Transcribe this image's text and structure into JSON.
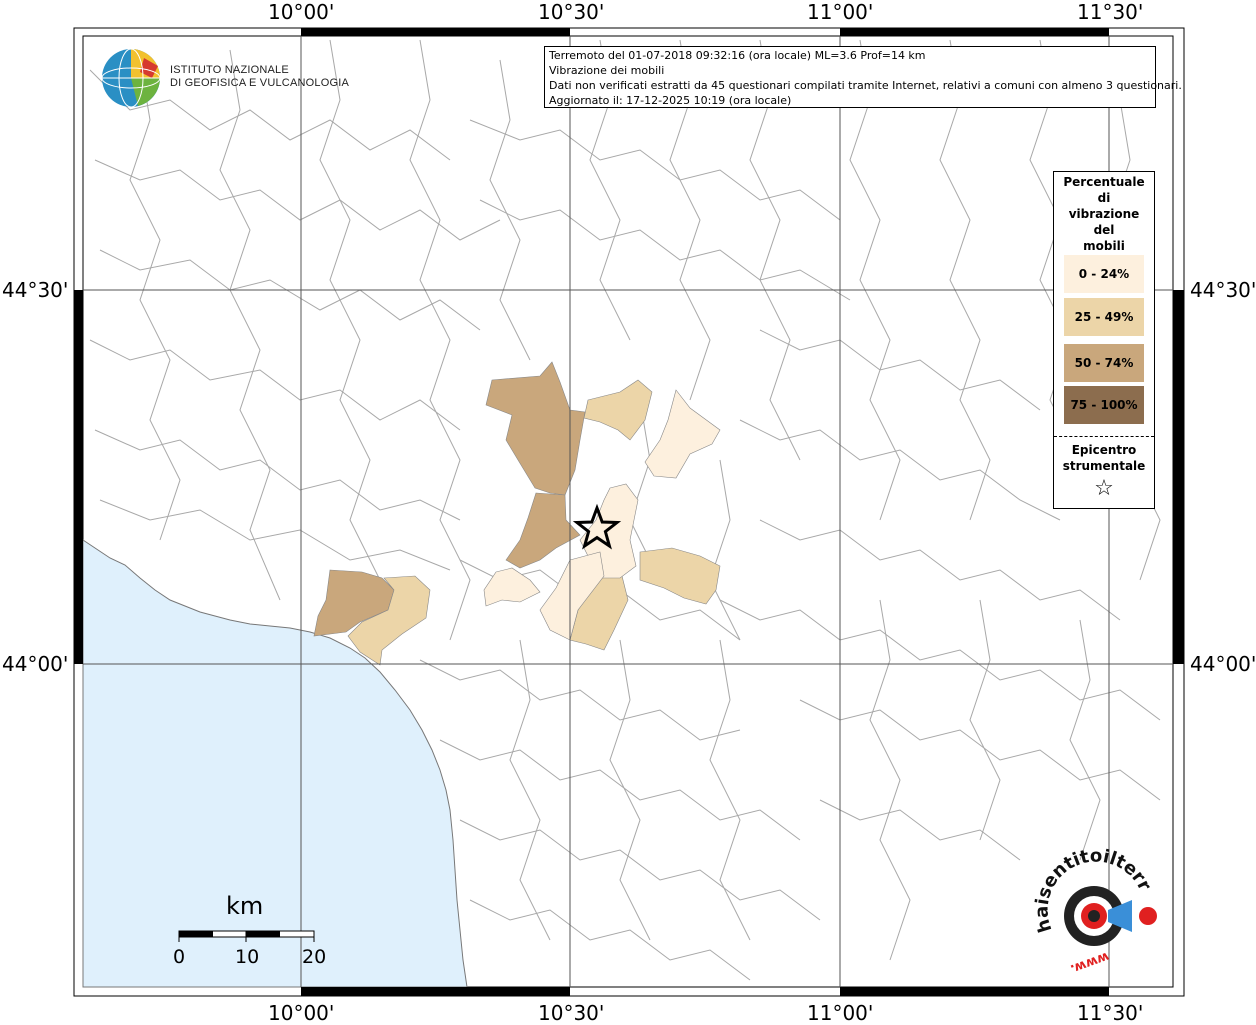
{
  "map": {
    "lon_labels": [
      "10°00'",
      "10°30'",
      "11°00'",
      "11°30'"
    ],
    "lat_labels": [
      "44°30'",
      "44°00'"
    ]
  },
  "infobox": {
    "line1": "Terremoto del 01-07-2018 09:32:16 (ora locale) ML=3.6 Prof=14 km",
    "line2": "Vibrazione dei mobili",
    "line3": "Dati non verificati estratti da 45 questionari compilati tramite Internet, relativi a comuni con almeno 3 questionari.",
    "line4": "Aggiornato il: 17-12-2025 10:19 (ora locale)"
  },
  "logo": {
    "line1": "ISTITUTO NAZIONALE",
    "line2": "DI GEOFISICA E VULCANOLOGIA",
    "icon": "ingv-globe-logo"
  },
  "legend": {
    "title_lines": [
      "Percentuale",
      "di",
      "vibrazione",
      "del",
      "mobili"
    ],
    "items": [
      {
        "label": "0 - 24%",
        "color": "#fdf0de"
      },
      {
        "label": "25 - 49%",
        "color": "#ecd5a8"
      },
      {
        "label": "50 - 74%",
        "color": "#c9a77c"
      },
      {
        "label": "75 - 100%",
        "color": "#8c6d4e"
      }
    ],
    "epicenter_lines": [
      "Epicentro",
      "strumentale"
    ],
    "epicenter_icon": "star-icon"
  },
  "scale": {
    "unit": "km",
    "ticks": [
      "0",
      "10",
      "20"
    ]
  },
  "colors": {
    "sea": "#dff0fc",
    "border_lines": "#a0a0a0",
    "frame": "#000000"
  },
  "watermark": {
    "text": "haisentitoilterremoto.it",
    "url_text": "www."
  }
}
